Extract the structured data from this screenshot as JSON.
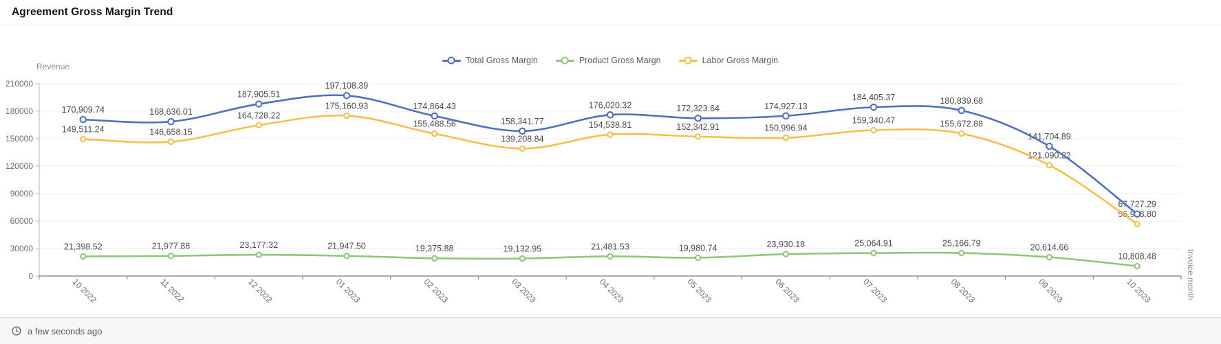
{
  "window": {
    "title": "Agreement Gross Margin Trend"
  },
  "footer": {
    "updated_text": "a few seconds ago",
    "icon": "clock-icon"
  },
  "chart_data": {
    "type": "line",
    "title": "Agreement Gross Margin Trend",
    "xlabel": "Invoice month",
    "ylabel": "Revenue",
    "legend_position": "top-center",
    "grid": true,
    "ylim": [
      0,
      210000
    ],
    "ytick_step": 30000,
    "yticks": [
      0,
      30000,
      60000,
      90000,
      120000,
      150000,
      180000,
      210000
    ],
    "categories": [
      "10 2022",
      "11 2022",
      "12 2022",
      "01 2023",
      "02 2023",
      "03 2023",
      "04 2023",
      "05 2023",
      "06 2023",
      "07 2023",
      "08 2023",
      "09 2023",
      "10 2023"
    ],
    "series": [
      {
        "name": "Total Gross Margin",
        "color": "#4f6fc4",
        "values": [
          170909.74,
          168636.01,
          187905.51,
          197108.39,
          174864.43,
          158341.77,
          176020.32,
          172323.64,
          174927.13,
          184405.37,
          180839.68,
          141704.89,
          67727.29
        ],
        "value_labels": [
          "170,909.74",
          "168,636.01",
          "187,905.51",
          "197,108.39",
          "174,864.43",
          "158,341.77",
          "176,020.32",
          "172,323.64",
          "174,927.13",
          "184,405.37",
          "180,839.68",
          "141,704.89",
          "67,727.29"
        ]
      },
      {
        "name": "Product Gross Margn",
        "color": "#8cc87a",
        "values": [
          21398.52,
          21977.88,
          23177.32,
          21947.5,
          19375.88,
          19132.95,
          21481.53,
          19980.74,
          23930.18,
          25064.91,
          25166.79,
          20614.66,
          10808.48
        ],
        "value_labels": [
          "21,398.52",
          "21,977.88",
          "23,177.32",
          "21,947.50",
          "19,375.88",
          "19,132.95",
          "21,481.53",
          "19,980.74",
          "23,930.18",
          "25,064.91",
          "25,166.79",
          "20,614.66",
          "10,808.48"
        ]
      },
      {
        "name": "Labor Gross Margin",
        "color": "#f5c04a",
        "values": [
          149511.24,
          146658.15,
          164728.22,
          175160.93,
          155488.56,
          139208.84,
          154538.81,
          152342.91,
          150996.94,
          159340.47,
          155672.88,
          121090.22,
          56918.8
        ],
        "value_labels": [
          "149,511.24",
          "146,658.15",
          "164,728.22",
          "175,160.93",
          "155,488.56",
          "139,208.84",
          "154,538.81",
          "152,342.91",
          "150,996.94",
          "159,340.47",
          "155,672.88",
          "121,090.22",
          "56,918.80"
        ]
      }
    ],
    "colors": {
      "grid_line": "#e8ecf2",
      "axis_line": "#8f8f8f",
      "y_axis_line": "#b5b5b5",
      "tick_label": "#6d6d6d",
      "axis_title": "#929292",
      "data_label": "#4d4d4d"
    }
  }
}
